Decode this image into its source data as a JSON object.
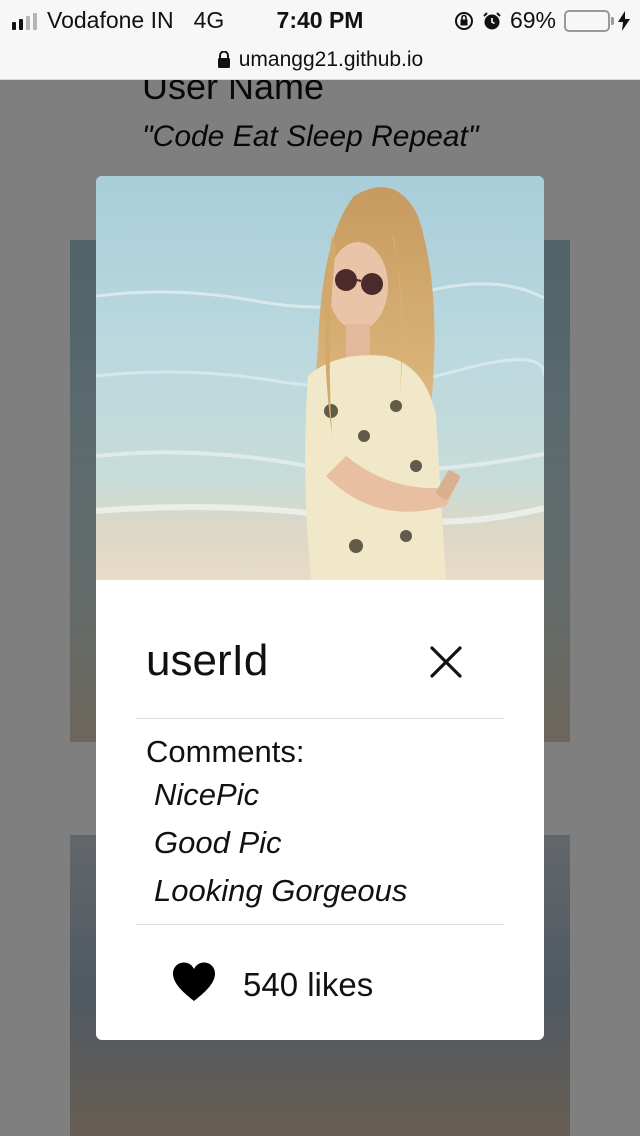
{
  "status_bar": {
    "carrier": "Vodafone IN",
    "network": "4G",
    "time": "7:40 PM",
    "battery": "69%",
    "battery_level": 0.69
  },
  "browser": {
    "url": "umangg21.github.io"
  },
  "profile": {
    "name": "User Name",
    "bio": "\"Code Eat Sleep Repeat\""
  },
  "modal": {
    "user_id": "userId",
    "comments_title": "Comments:",
    "comments": [
      "NicePic",
      "Good Pic",
      "Looking Gorgeous"
    ],
    "likes": "540 likes"
  },
  "icons": {
    "lock": "lock-icon",
    "close": "close-icon",
    "like": "heart-icon"
  },
  "colors": {
    "overlay": "#000000",
    "battery_fill": "#4cd964",
    "modal_bg": "#ffffff"
  }
}
